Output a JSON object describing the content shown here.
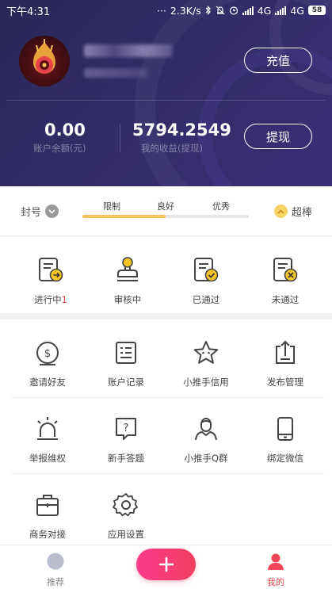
{
  "status_bar": {
    "time": "下午4:31",
    "speed": "2.3K/s",
    "network1": "4G",
    "network2": "4G",
    "battery": "58"
  },
  "account": {
    "recharge_label": "充值",
    "withdraw_label": "提现",
    "balance_value": "0.00",
    "balance_label": "账户余额(元)",
    "earnings_value": "5794.2549",
    "earnings_label": "我的收益(提现)"
  },
  "level": {
    "left_label": "封号",
    "right_label": "超棒",
    "progress_fraction": 0.5,
    "marks": [
      "限制",
      "良好",
      "优秀"
    ]
  },
  "orders": {
    "items": [
      {
        "label": "进行中",
        "badge": "1",
        "icon": "in-progress-icon"
      },
      {
        "label": "审核中",
        "badge": "",
        "icon": "stamp-icon"
      },
      {
        "label": "已通过",
        "badge": "",
        "icon": "approved-icon"
      },
      {
        "label": "未通过",
        "badge": "",
        "icon": "rejected-icon"
      }
    ]
  },
  "services": {
    "items": [
      {
        "label": "邀请好友",
        "icon": "coin-icon"
      },
      {
        "label": "账户记录",
        "icon": "record-icon"
      },
      {
        "label": "小推手信用",
        "icon": "star-icon"
      },
      {
        "label": "发布管理",
        "icon": "upload-icon"
      },
      {
        "label": "举报维权",
        "icon": "alarm-icon"
      },
      {
        "label": "新手答题",
        "icon": "question-icon"
      },
      {
        "label": "小推手Q群",
        "icon": "person-icon"
      },
      {
        "label": "绑定微信",
        "icon": "phone-icon"
      },
      {
        "label": "商务对接",
        "icon": "briefcase-icon"
      },
      {
        "label": "应用设置",
        "icon": "settings-icon"
      }
    ]
  },
  "tabbar": {
    "recommend_label": "推荐",
    "mine_label": "我的",
    "add_symbol": "+"
  },
  "colors": {
    "header_bg": "#2f2a62",
    "accent_red": "#e8434a",
    "accent_pink": "#fb3a8c",
    "accent_gold": "#f6c35b",
    "icon_yellow": "#f5c527"
  }
}
